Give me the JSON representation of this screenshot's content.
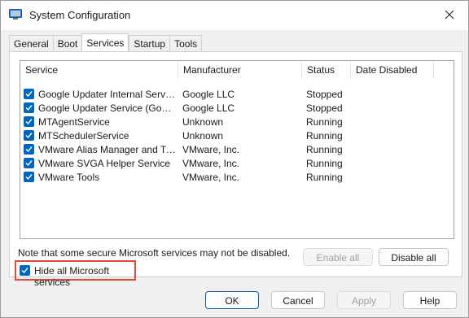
{
  "window": {
    "title": "System Configuration",
    "app_icon": "system-configuration-icon",
    "close_icon": "close-icon"
  },
  "tabs": [
    {
      "label": "General",
      "active": false
    },
    {
      "label": "Boot",
      "active": false
    },
    {
      "label": "Services",
      "active": true
    },
    {
      "label": "Startup",
      "active": false
    },
    {
      "label": "Tools",
      "active": false
    }
  ],
  "services_table": {
    "columns": [
      "Service",
      "Manufacturer",
      "Status",
      "Date Disabled"
    ],
    "rows": [
      {
        "checked": true,
        "service": "Google Updater Internal Service...",
        "manufacturer": "Google LLC",
        "status": "Stopped",
        "date_disabled": ""
      },
      {
        "checked": true,
        "service": "Google Updater Service (Google...",
        "manufacturer": "Google LLC",
        "status": "Stopped",
        "date_disabled": ""
      },
      {
        "checked": true,
        "service": "MTAgentService",
        "manufacturer": "Unknown",
        "status": "Running",
        "date_disabled": ""
      },
      {
        "checked": true,
        "service": "MTSchedulerService",
        "manufacturer": "Unknown",
        "status": "Running",
        "date_disabled": ""
      },
      {
        "checked": true,
        "service": "VMware Alias Manager and Ticke...",
        "manufacturer": "VMware, Inc.",
        "status": "Running",
        "date_disabled": ""
      },
      {
        "checked": true,
        "service": "VMware SVGA Helper Service",
        "manufacturer": "VMware, Inc.",
        "status": "Running",
        "date_disabled": ""
      },
      {
        "checked": true,
        "service": "VMware Tools",
        "manufacturer": "VMware, Inc.",
        "status": "Running",
        "date_disabled": ""
      }
    ]
  },
  "note": "Note that some secure Microsoft services may not be disabled.",
  "buttons": {
    "enable_all": "Enable all",
    "disable_all": "Disable all",
    "ok": "OK",
    "cancel": "Cancel",
    "apply": "Apply",
    "help": "Help"
  },
  "hide_microsoft": {
    "label": "Hide all Microsoft services",
    "checked": true
  },
  "colors": {
    "accent": "#0067c0",
    "highlight_border": "#e04a3a"
  }
}
